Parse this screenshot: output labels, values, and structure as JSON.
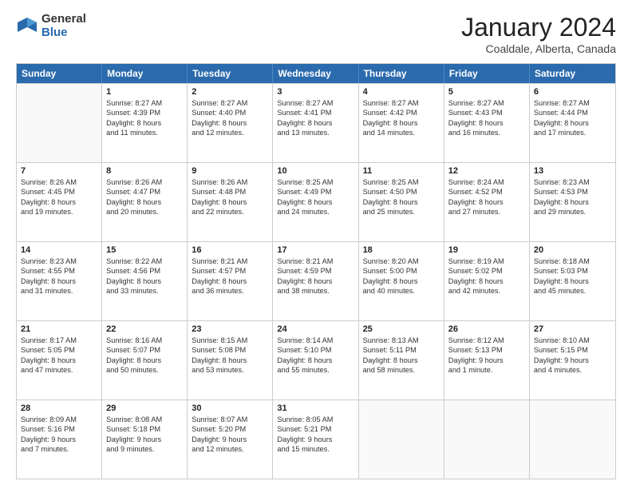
{
  "logo": {
    "general": "General",
    "blue": "Blue"
  },
  "title": "January 2024",
  "location": "Coaldale, Alberta, Canada",
  "header_days": [
    "Sunday",
    "Monday",
    "Tuesday",
    "Wednesday",
    "Thursday",
    "Friday",
    "Saturday"
  ],
  "weeks": [
    [
      {
        "day": "",
        "lines": []
      },
      {
        "day": "1",
        "lines": [
          "Sunrise: 8:27 AM",
          "Sunset: 4:39 PM",
          "Daylight: 8 hours",
          "and 11 minutes."
        ]
      },
      {
        "day": "2",
        "lines": [
          "Sunrise: 8:27 AM",
          "Sunset: 4:40 PM",
          "Daylight: 8 hours",
          "and 12 minutes."
        ]
      },
      {
        "day": "3",
        "lines": [
          "Sunrise: 8:27 AM",
          "Sunset: 4:41 PM",
          "Daylight: 8 hours",
          "and 13 minutes."
        ]
      },
      {
        "day": "4",
        "lines": [
          "Sunrise: 8:27 AM",
          "Sunset: 4:42 PM",
          "Daylight: 8 hours",
          "and 14 minutes."
        ]
      },
      {
        "day": "5",
        "lines": [
          "Sunrise: 8:27 AM",
          "Sunset: 4:43 PM",
          "Daylight: 8 hours",
          "and 16 minutes."
        ]
      },
      {
        "day": "6",
        "lines": [
          "Sunrise: 8:27 AM",
          "Sunset: 4:44 PM",
          "Daylight: 8 hours",
          "and 17 minutes."
        ]
      }
    ],
    [
      {
        "day": "7",
        "lines": [
          "Sunrise: 8:26 AM",
          "Sunset: 4:45 PM",
          "Daylight: 8 hours",
          "and 19 minutes."
        ]
      },
      {
        "day": "8",
        "lines": [
          "Sunrise: 8:26 AM",
          "Sunset: 4:47 PM",
          "Daylight: 8 hours",
          "and 20 minutes."
        ]
      },
      {
        "day": "9",
        "lines": [
          "Sunrise: 8:26 AM",
          "Sunset: 4:48 PM",
          "Daylight: 8 hours",
          "and 22 minutes."
        ]
      },
      {
        "day": "10",
        "lines": [
          "Sunrise: 8:25 AM",
          "Sunset: 4:49 PM",
          "Daylight: 8 hours",
          "and 24 minutes."
        ]
      },
      {
        "day": "11",
        "lines": [
          "Sunrise: 8:25 AM",
          "Sunset: 4:50 PM",
          "Daylight: 8 hours",
          "and 25 minutes."
        ]
      },
      {
        "day": "12",
        "lines": [
          "Sunrise: 8:24 AM",
          "Sunset: 4:52 PM",
          "Daylight: 8 hours",
          "and 27 minutes."
        ]
      },
      {
        "day": "13",
        "lines": [
          "Sunrise: 8:23 AM",
          "Sunset: 4:53 PM",
          "Daylight: 8 hours",
          "and 29 minutes."
        ]
      }
    ],
    [
      {
        "day": "14",
        "lines": [
          "Sunrise: 8:23 AM",
          "Sunset: 4:55 PM",
          "Daylight: 8 hours",
          "and 31 minutes."
        ]
      },
      {
        "day": "15",
        "lines": [
          "Sunrise: 8:22 AM",
          "Sunset: 4:56 PM",
          "Daylight: 8 hours",
          "and 33 minutes."
        ]
      },
      {
        "day": "16",
        "lines": [
          "Sunrise: 8:21 AM",
          "Sunset: 4:57 PM",
          "Daylight: 8 hours",
          "and 36 minutes."
        ]
      },
      {
        "day": "17",
        "lines": [
          "Sunrise: 8:21 AM",
          "Sunset: 4:59 PM",
          "Daylight: 8 hours",
          "and 38 minutes."
        ]
      },
      {
        "day": "18",
        "lines": [
          "Sunrise: 8:20 AM",
          "Sunset: 5:00 PM",
          "Daylight: 8 hours",
          "and 40 minutes."
        ]
      },
      {
        "day": "19",
        "lines": [
          "Sunrise: 8:19 AM",
          "Sunset: 5:02 PM",
          "Daylight: 8 hours",
          "and 42 minutes."
        ]
      },
      {
        "day": "20",
        "lines": [
          "Sunrise: 8:18 AM",
          "Sunset: 5:03 PM",
          "Daylight: 8 hours",
          "and 45 minutes."
        ]
      }
    ],
    [
      {
        "day": "21",
        "lines": [
          "Sunrise: 8:17 AM",
          "Sunset: 5:05 PM",
          "Daylight: 8 hours",
          "and 47 minutes."
        ]
      },
      {
        "day": "22",
        "lines": [
          "Sunrise: 8:16 AM",
          "Sunset: 5:07 PM",
          "Daylight: 8 hours",
          "and 50 minutes."
        ]
      },
      {
        "day": "23",
        "lines": [
          "Sunrise: 8:15 AM",
          "Sunset: 5:08 PM",
          "Daylight: 8 hours",
          "and 53 minutes."
        ]
      },
      {
        "day": "24",
        "lines": [
          "Sunrise: 8:14 AM",
          "Sunset: 5:10 PM",
          "Daylight: 8 hours",
          "and 55 minutes."
        ]
      },
      {
        "day": "25",
        "lines": [
          "Sunrise: 8:13 AM",
          "Sunset: 5:11 PM",
          "Daylight: 8 hours",
          "and 58 minutes."
        ]
      },
      {
        "day": "26",
        "lines": [
          "Sunrise: 8:12 AM",
          "Sunset: 5:13 PM",
          "Daylight: 9 hours",
          "and 1 minute."
        ]
      },
      {
        "day": "27",
        "lines": [
          "Sunrise: 8:10 AM",
          "Sunset: 5:15 PM",
          "Daylight: 9 hours",
          "and 4 minutes."
        ]
      }
    ],
    [
      {
        "day": "28",
        "lines": [
          "Sunrise: 8:09 AM",
          "Sunset: 5:16 PM",
          "Daylight: 9 hours",
          "and 7 minutes."
        ]
      },
      {
        "day": "29",
        "lines": [
          "Sunrise: 8:08 AM",
          "Sunset: 5:18 PM",
          "Daylight: 9 hours",
          "and 9 minutes."
        ]
      },
      {
        "day": "30",
        "lines": [
          "Sunrise: 8:07 AM",
          "Sunset: 5:20 PM",
          "Daylight: 9 hours",
          "and 12 minutes."
        ]
      },
      {
        "day": "31",
        "lines": [
          "Sunrise: 8:05 AM",
          "Sunset: 5:21 PM",
          "Daylight: 9 hours",
          "and 15 minutes."
        ]
      },
      {
        "day": "",
        "lines": []
      },
      {
        "day": "",
        "lines": []
      },
      {
        "day": "",
        "lines": []
      }
    ]
  ]
}
